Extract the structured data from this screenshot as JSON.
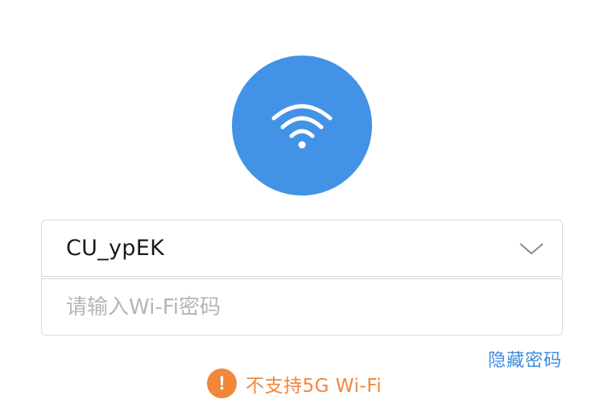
{
  "wifi": {
    "icon": "wifi-icon",
    "circle_color": "#4293e6"
  },
  "network": {
    "ssid": "CU_ypEK",
    "dropdown_icon": "chevron-down-icon"
  },
  "password": {
    "placeholder": "请输入Wi-Fi密码",
    "value": ""
  },
  "hide_password_label": "隐藏密码",
  "warning": {
    "icon": "exclamation-icon",
    "icon_text": "!",
    "text": "不支持5G Wi-Fi",
    "color": "#f0873a"
  },
  "colors": {
    "accent": "#4293e6",
    "link": "#3d8be0",
    "warning": "#f0873a"
  }
}
